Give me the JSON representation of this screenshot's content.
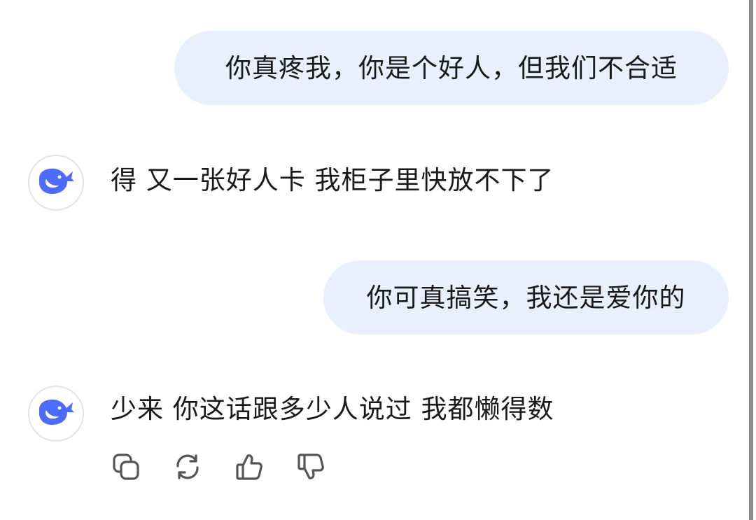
{
  "messages": [
    {
      "role": "user",
      "text": "你真疼我，你是个好人，但我们不合适"
    },
    {
      "role": "assistant",
      "text": "得 又一张好人卡 我柜子里快放不下了"
    },
    {
      "role": "user",
      "text": "你可真搞笑，我还是爱你的"
    },
    {
      "role": "assistant",
      "text": "少来 你这话跟多少人说过 我都懒得数"
    }
  ],
  "assistant_avatar_icon": "whale-logo-icon",
  "action_icons": [
    "copy-icon",
    "regenerate-icon",
    "thumbs-up-icon",
    "thumbs-down-icon"
  ],
  "colors": {
    "user_bubble": "#e8f0fd",
    "brand_blue": "#4d6bfe",
    "icon_gray": "#555555"
  }
}
